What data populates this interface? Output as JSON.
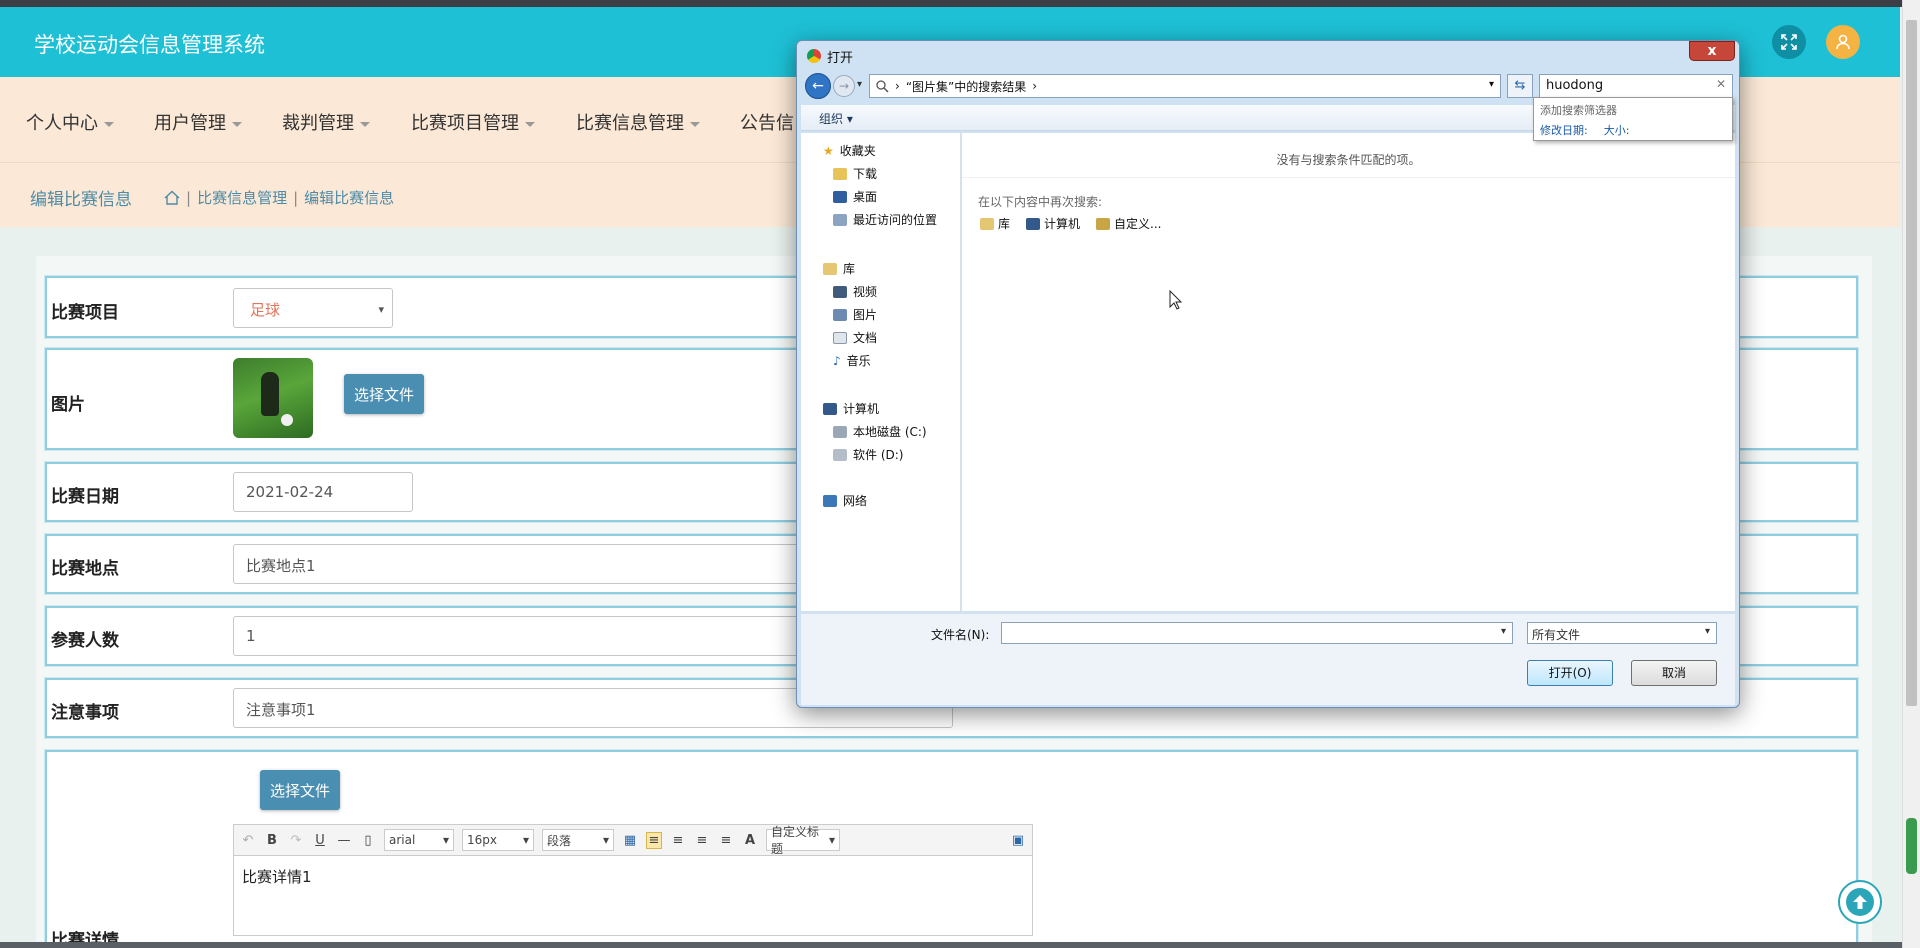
{
  "header": {
    "title": "学校运动会信息管理系统"
  },
  "nav": {
    "items": [
      {
        "label": "个人中心"
      },
      {
        "label": "用户管理"
      },
      {
        "label": "裁判管理"
      },
      {
        "label": "比赛项目管理"
      },
      {
        "label": "比赛信息管理"
      },
      {
        "label": "公告信"
      }
    ]
  },
  "breadcrumb": {
    "page_title": "编辑比赛信息",
    "path1": "比赛信息管理",
    "path2": "编辑比赛信息"
  },
  "form": {
    "project_label": "比赛项目",
    "project_value": "足球",
    "image_label": "图片",
    "choose_file": "选择文件",
    "date_label": "比赛日期",
    "date_value": "2021-02-24",
    "location_label": "比赛地点",
    "location_value": "比赛地点1",
    "participants_label": "参赛人数",
    "participants_value": "1",
    "notes_label": "注意事项",
    "notes_value": "注意事项1",
    "detail_label": "比赛详情",
    "detail_choose_file": "选择文件",
    "detail_value": "比赛详情1"
  },
  "editor": {
    "bold": "B",
    "underline": "U",
    "font": "arial",
    "size": "16px",
    "paragraph": "段落",
    "font_color": "A",
    "custom_title": "自定义标题"
  },
  "dialog": {
    "title": "打开",
    "close": "x",
    "address": "“图片集”中的搜索结果",
    "search_value": "huodong",
    "search_hint": "添加搜索筛选器",
    "filter_date": "修改日期:",
    "filter_size": "大小:",
    "organize": "组织",
    "favorites": "收藏夹",
    "downloads": "下载",
    "desktop": "桌面",
    "recent": "最近访问的位置",
    "libraries": "库",
    "videos": "视频",
    "pictures": "图片",
    "documents": "文档",
    "music": "音乐",
    "computer": "计算机",
    "disk_c": "本地磁盘 (C:)",
    "disk_d": "软件 (D:)",
    "network": "网络",
    "empty_message": "没有与搜索条件匹配的项。",
    "search_again_label": "在以下内容中再次搜索:",
    "again_library": "库",
    "again_computer": "计算机",
    "again_custom": "自定义...",
    "filename_label": "文件名(N):",
    "filetype": "所有文件",
    "open_button": "打开(O)",
    "cancel_button": "取消"
  }
}
